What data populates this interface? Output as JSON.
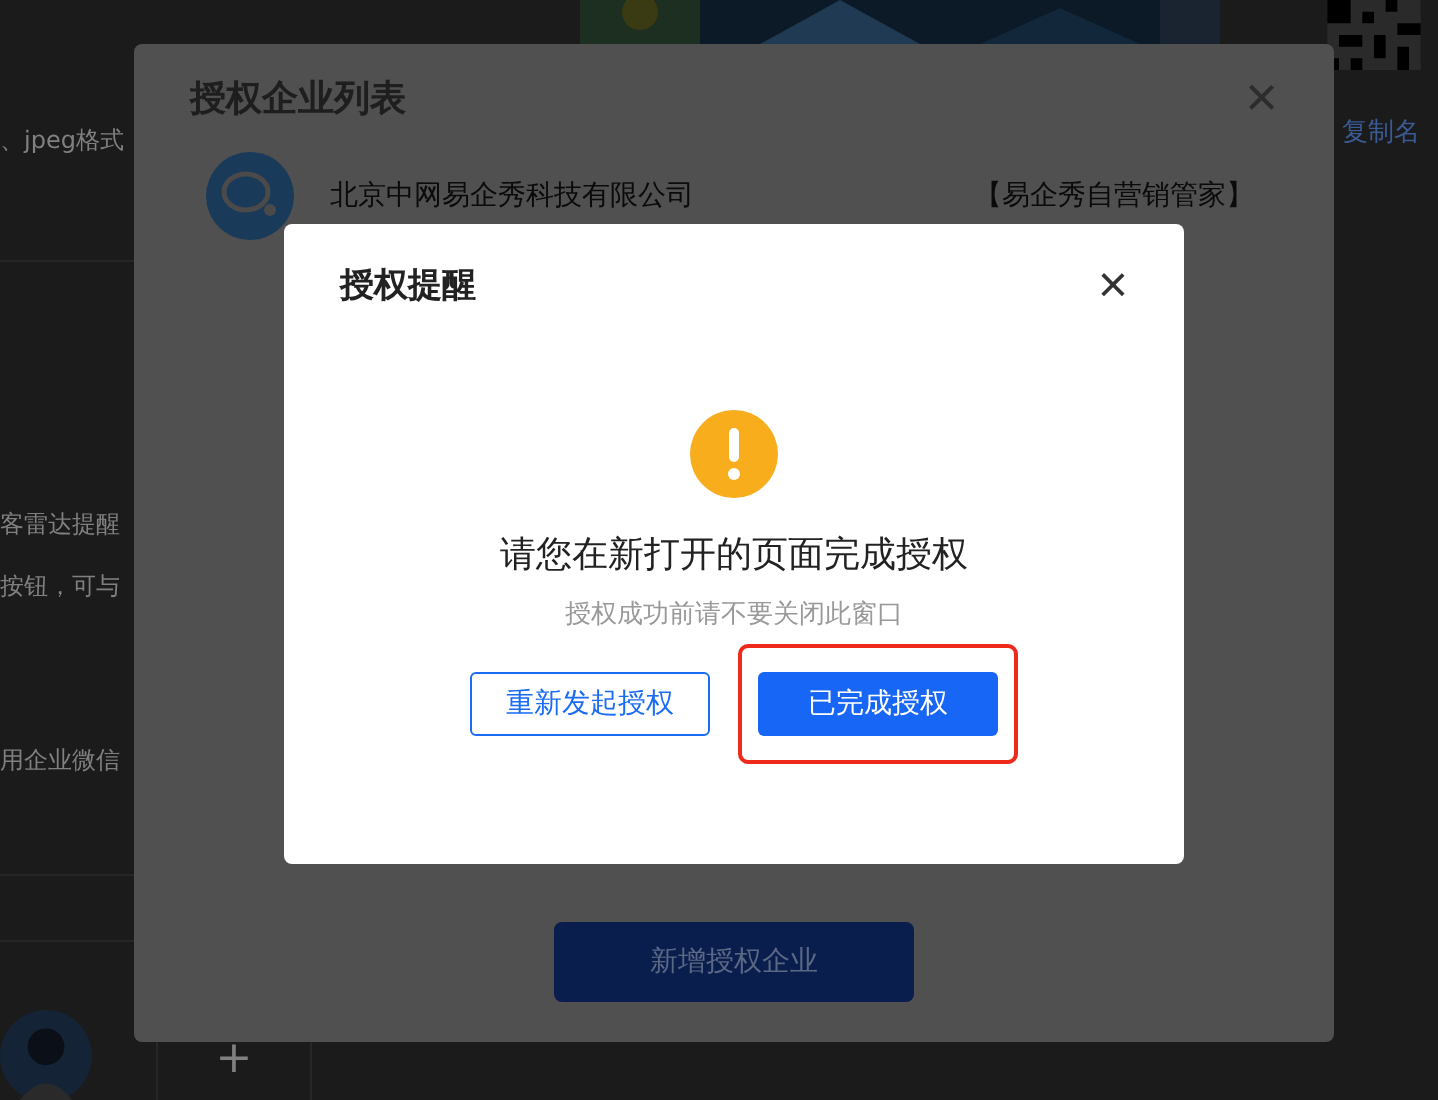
{
  "background": {
    "texts": [
      "、jpeg格式",
      "客雷达提醒",
      "按钮，可与",
      "用企业微信"
    ],
    "copy_link": "复制名",
    "add_tile": "+"
  },
  "auth_list_dialog": {
    "title": "授权企业列表",
    "close": "×",
    "companies": [
      {
        "name": "北京中网易企秀科技有限公司",
        "tag": "【易企秀自营销管家】"
      }
    ],
    "add_button": "新增授权企业"
  },
  "auth_reminder_dialog": {
    "title": "授权提醒",
    "close": "×",
    "message": "请您在新打开的页面完成授权",
    "hint": "授权成功前请不要关闭此窗口",
    "buttons": [
      {
        "label": "重新发起授权",
        "kind": "secondary",
        "highlighted": false
      },
      {
        "label": "已完成授权",
        "kind": "primary",
        "highlighted": true
      }
    ]
  }
}
